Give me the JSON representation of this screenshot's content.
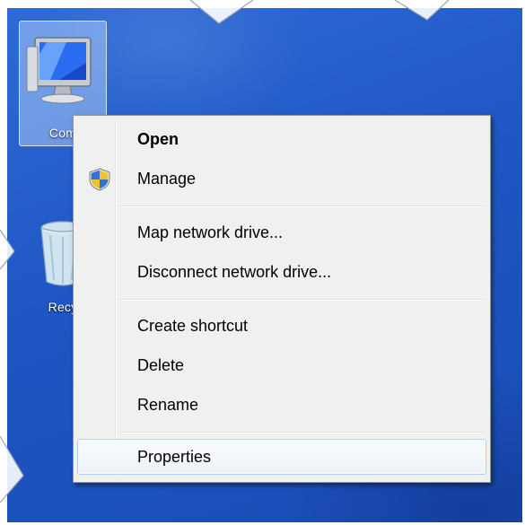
{
  "desktop": {
    "icons": [
      {
        "label": "Com"
      },
      {
        "label": "Recy"
      }
    ]
  },
  "context_menu": {
    "items": [
      {
        "label": "Open",
        "bold": true
      },
      {
        "label": "Manage",
        "icon": "uac-shield-icon"
      },
      {
        "label": "Map network drive..."
      },
      {
        "label": "Disconnect network drive..."
      },
      {
        "label": "Create shortcut"
      },
      {
        "label": "Delete"
      },
      {
        "label": "Rename"
      },
      {
        "label": "Properties",
        "highlighted": true
      }
    ]
  },
  "colors": {
    "desktop_background": "#1f56c4",
    "menu_background": "#f0f0f0",
    "menu_highlight_border": "#aecff7"
  }
}
